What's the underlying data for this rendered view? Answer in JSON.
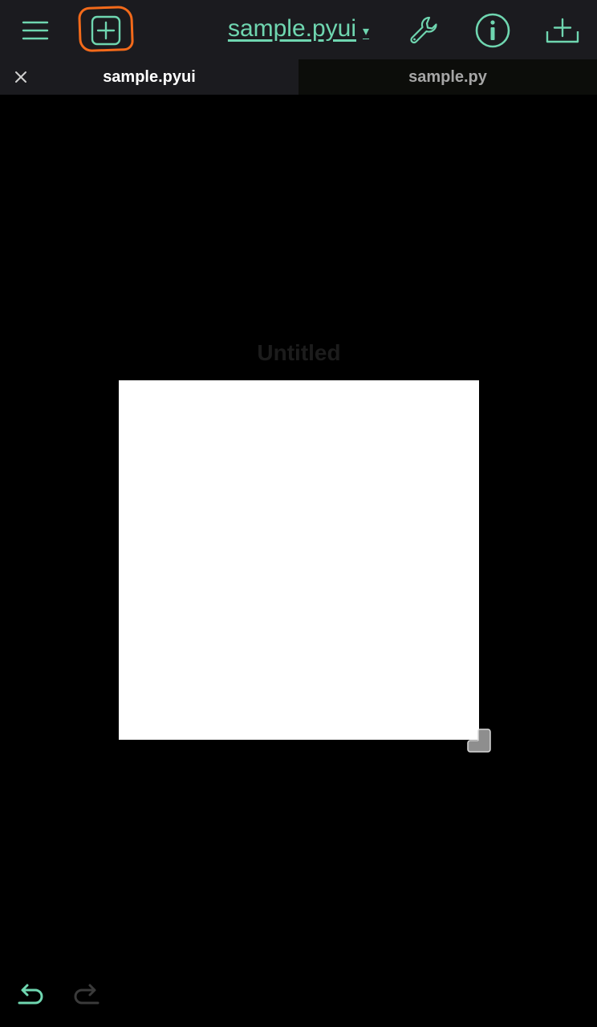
{
  "toolbar": {
    "menu_icon": "hamburger-menu-icon",
    "add_view_icon": "plus-square-icon",
    "title": "sample.pyui",
    "title_caret": "▾",
    "wrench_icon": "wrench-icon",
    "info_icon": "info-circle-icon",
    "add_icon": "plus-tray-icon"
  },
  "tabs": [
    {
      "label": "sample.pyui",
      "active": true
    },
    {
      "label": "sample.py",
      "active": false
    }
  ],
  "canvas": {
    "view_title": "Untitled"
  },
  "colors": {
    "accent": "#6fd6b0",
    "toolbar_bg": "#1b1b1f",
    "highlight": "#f36a1a",
    "canvas_bg": "#ffffff"
  }
}
